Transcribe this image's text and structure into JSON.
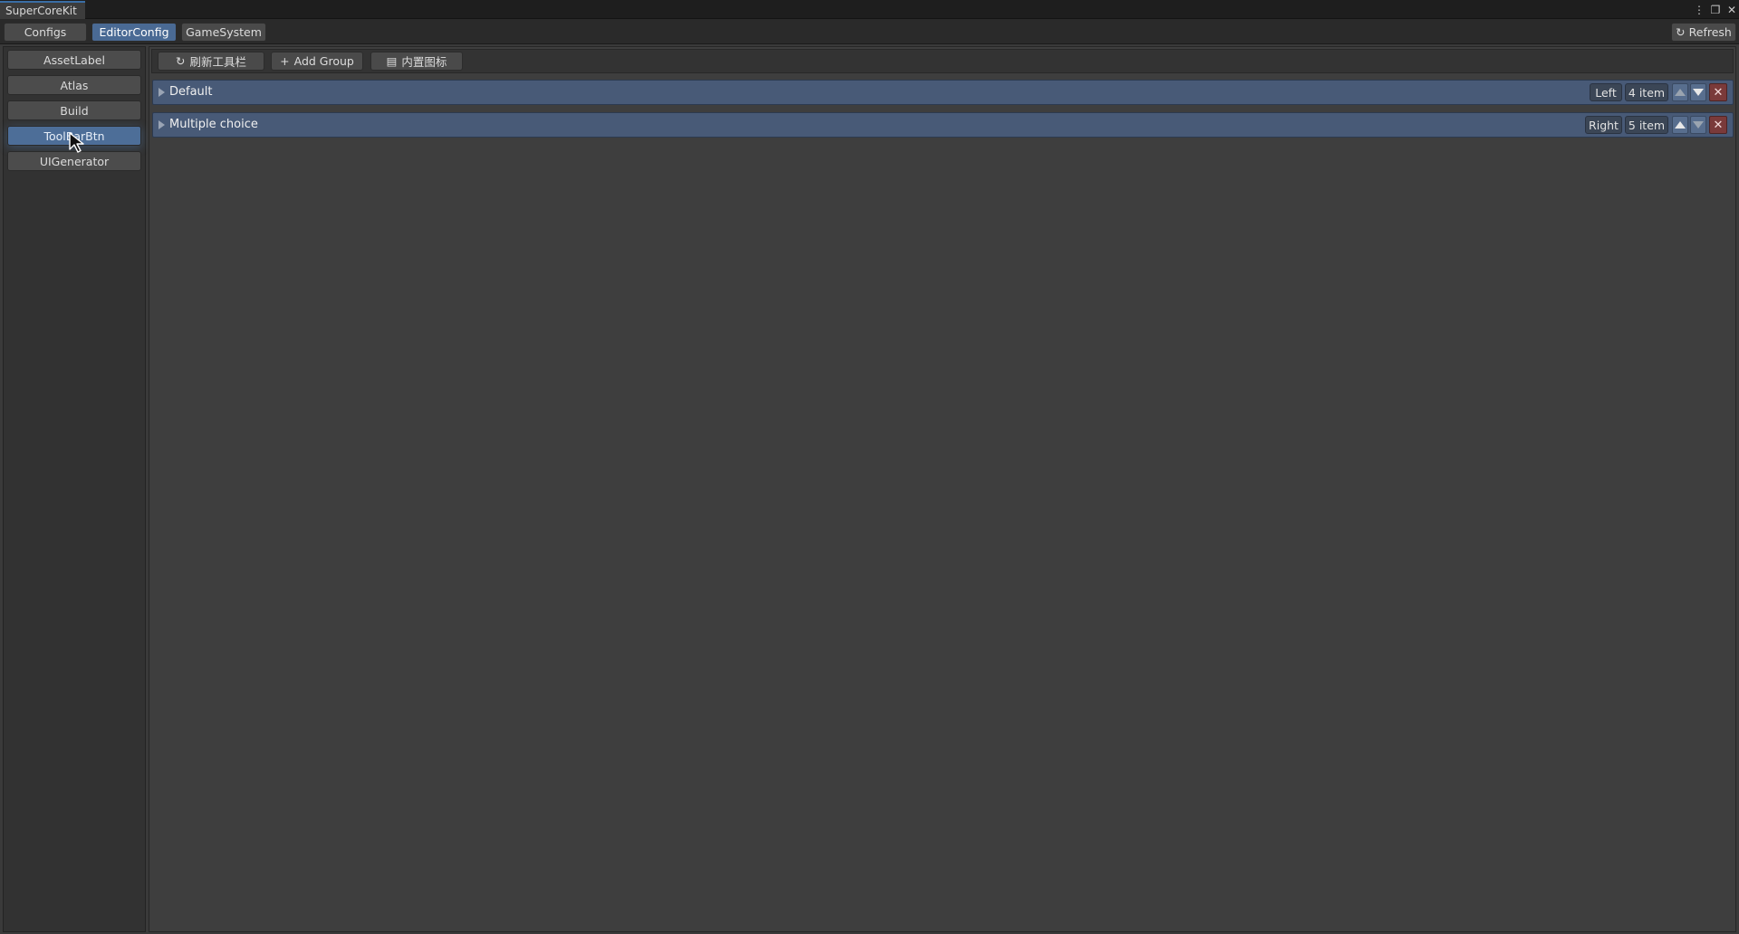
{
  "window": {
    "title": "SuperCoreKit",
    "controls": {
      "more_icon": "⋮",
      "restore_icon": "❐",
      "close_icon": "✕"
    }
  },
  "top_tabs": [
    {
      "label": "Configs",
      "active": false
    },
    {
      "label": "EditorConfig",
      "active": true
    },
    {
      "label": "GameSystem",
      "active": false
    }
  ],
  "refresh": {
    "icon": "↻",
    "label": "Refresh"
  },
  "sidebar": {
    "items": [
      {
        "label": "AssetLabel",
        "active": false
      },
      {
        "label": "Atlas",
        "active": false
      },
      {
        "label": "Build",
        "active": false
      },
      {
        "label": "ToolBarBtn",
        "active": true
      },
      {
        "label": "UIGenerator",
        "active": false
      }
    ]
  },
  "toolbar": {
    "refresh_toolbar": {
      "icon": "↻",
      "label": "刷新工具栏"
    },
    "add_group": {
      "icon": "+",
      "label": "Add Group"
    },
    "builtin_icons": {
      "icon": "▤",
      "label": "内置图标"
    }
  },
  "groups": [
    {
      "name": "Default",
      "side": "Left",
      "count": "4 item",
      "up_enabled": false,
      "down_enabled": true,
      "delete_icon": "✕"
    },
    {
      "name": "Multiple choice",
      "side": "Right",
      "count": "5 item",
      "up_enabled": true,
      "down_enabled": false,
      "delete_icon": "✕"
    }
  ],
  "colors": {
    "accent": "#4a6a94",
    "group_bg": "#485a77",
    "delete": "#7a3a3a"
  }
}
